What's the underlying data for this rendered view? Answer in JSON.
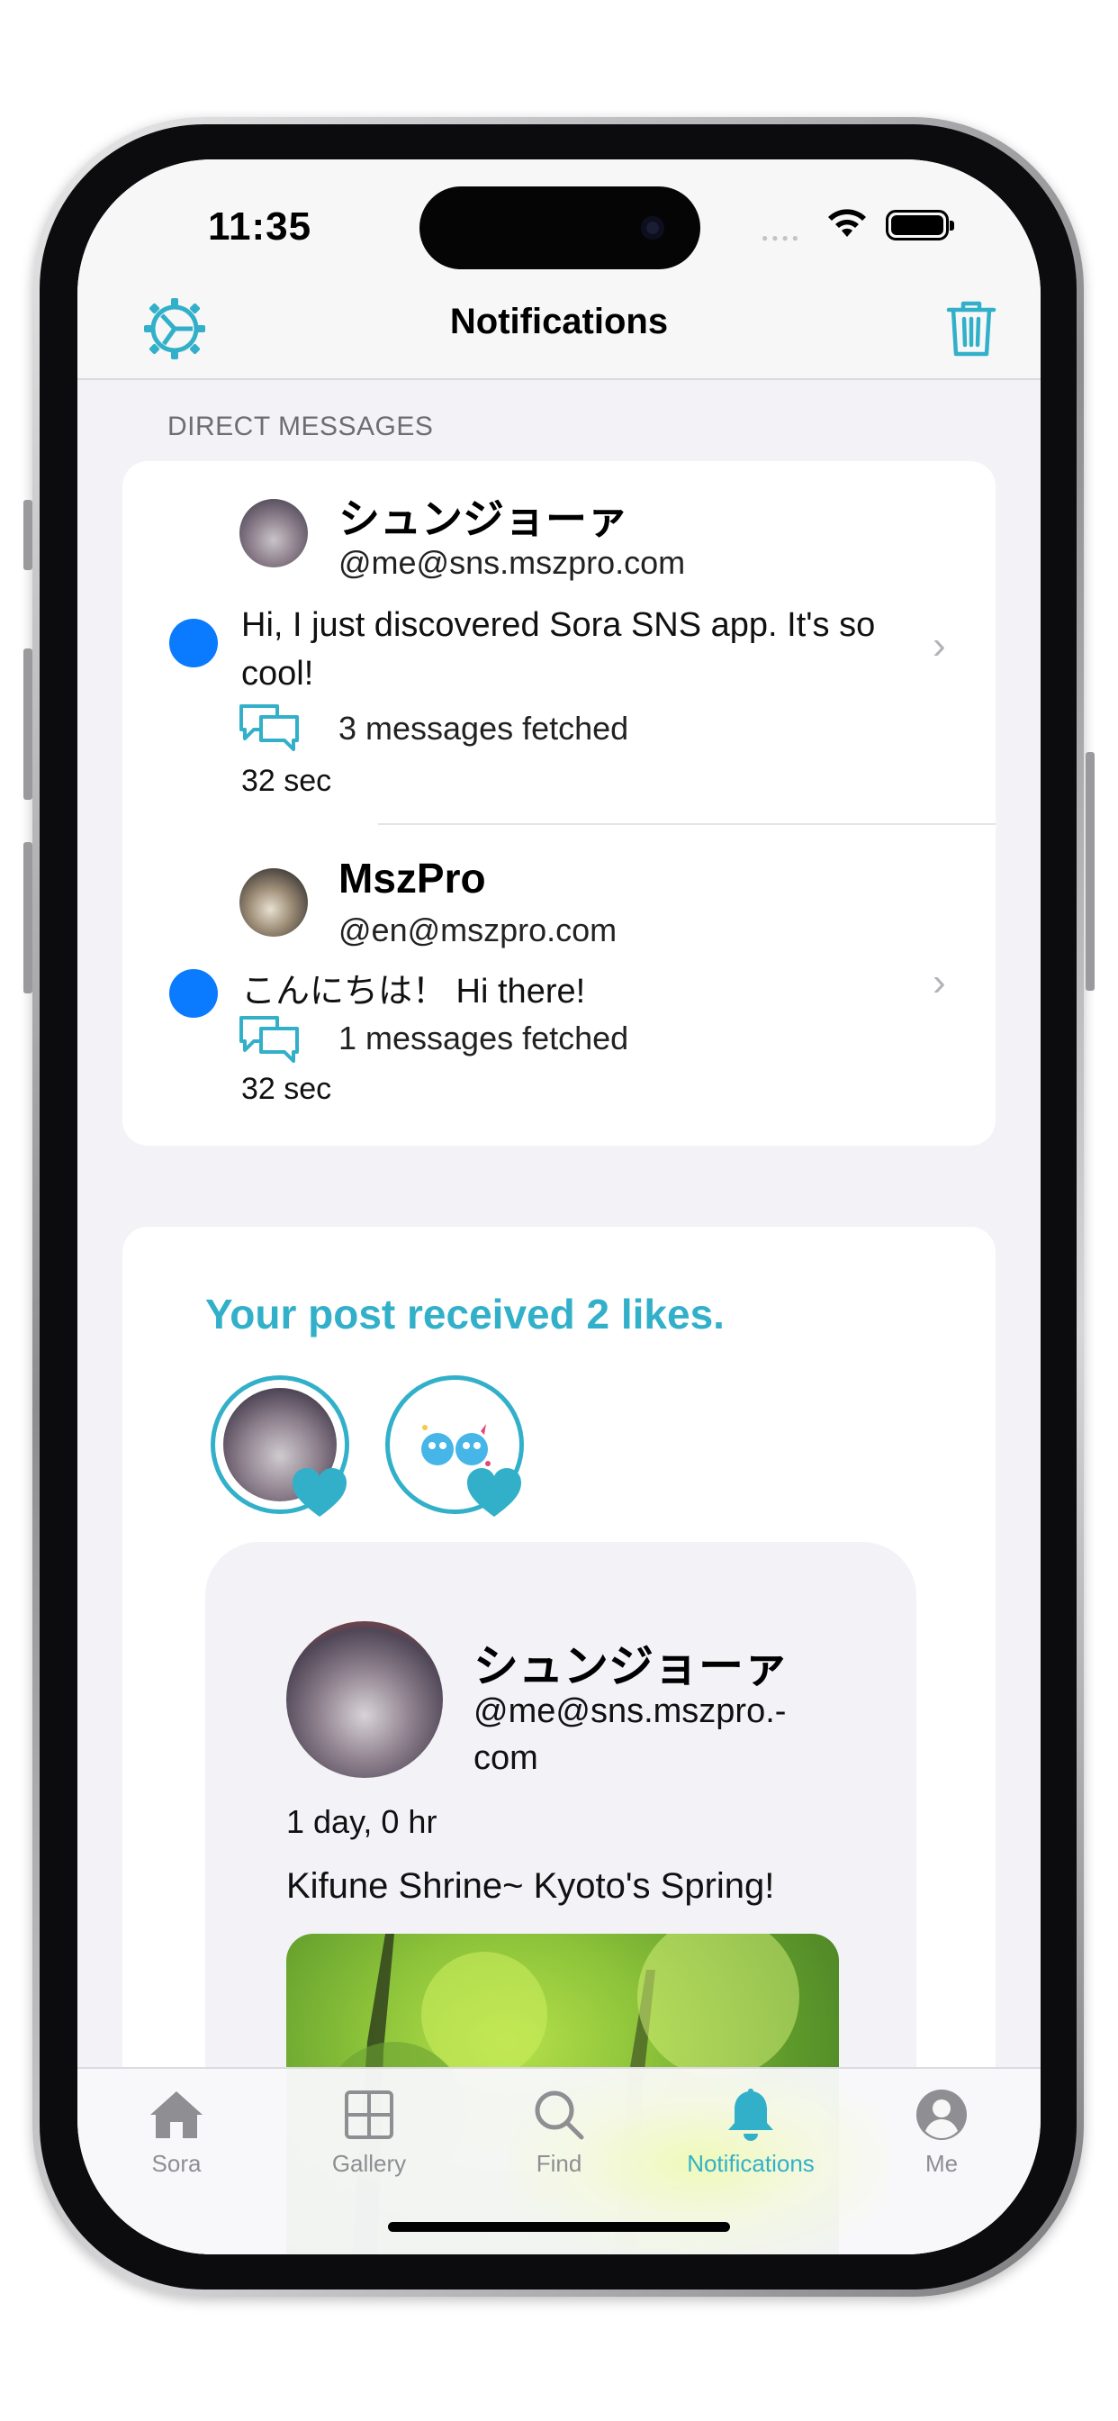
{
  "status_bar": {
    "time": "11:35"
  },
  "nav": {
    "title": "Notifications"
  },
  "direct_messages": {
    "header": "DIRECT MESSAGES",
    "items": [
      {
        "name": "シュンジョーァ",
        "handle": "@me@sns.mszpro.com",
        "message": "Hi, I just discovered Sora SNS app. It's so cool!",
        "fetched": "3 messages fetched",
        "ago": "32 sec"
      },
      {
        "name": "MszPro",
        "handle": "@en@mszpro.com",
        "message": "こんにちは！ Hi there!",
        "fetched": "1 messages fetched",
        "ago": "32 sec"
      }
    ]
  },
  "likes": {
    "title": "Your post received 2 likes.",
    "post": {
      "name": "シュンジョーァ",
      "handle": "@me@sns.mszpro.-\ncom",
      "time": "1 day, 0 hr",
      "text": "Kifune Shrine~ Kyoto's Spring!"
    }
  },
  "tabs": [
    {
      "label": "Sora",
      "icon": "house-icon"
    },
    {
      "label": "Gallery",
      "icon": "grid-icon"
    },
    {
      "label": "Find",
      "icon": "magnifier-icon"
    },
    {
      "label": "Notifications",
      "icon": "bell-icon",
      "active": true
    },
    {
      "label": "Me",
      "icon": "person-circle-icon"
    }
  ],
  "colors": {
    "accent": "#33b0c9",
    "unread": "#0a7aff",
    "inactive_tab": "#8e8e93"
  }
}
